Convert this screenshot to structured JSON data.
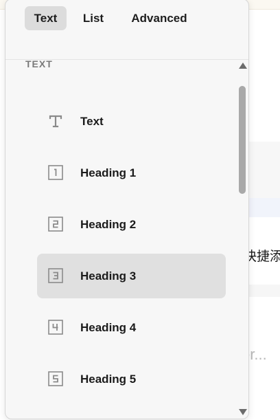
{
  "tabs": [
    {
      "label": "Text",
      "active": true
    },
    {
      "label": "List",
      "active": false
    },
    {
      "label": "Advanced",
      "active": false
    }
  ],
  "section": {
    "label": "TEXT"
  },
  "items": [
    {
      "label": "Text",
      "icon": "text-type-icon",
      "selected": false
    },
    {
      "label": "Heading 1",
      "icon": "heading-1-icon",
      "selected": false
    },
    {
      "label": "Heading 2",
      "icon": "heading-2-icon",
      "selected": false
    },
    {
      "label": "Heading 3",
      "icon": "heading-3-icon",
      "selected": true
    },
    {
      "label": "Heading 4",
      "icon": "heading-4-icon",
      "selected": false
    },
    {
      "label": "Heading 5",
      "icon": "heading-5-icon",
      "selected": false
    }
  ],
  "background": {
    "partial_text": "快捷添",
    "placeholder_fragment": "er..."
  },
  "colors": {
    "panel_bg": "#f7f7f7",
    "active_tab_bg": "#dcdcdc",
    "selected_item_bg": "#e0e0e0",
    "icon_gray": "#8a8a8a"
  }
}
